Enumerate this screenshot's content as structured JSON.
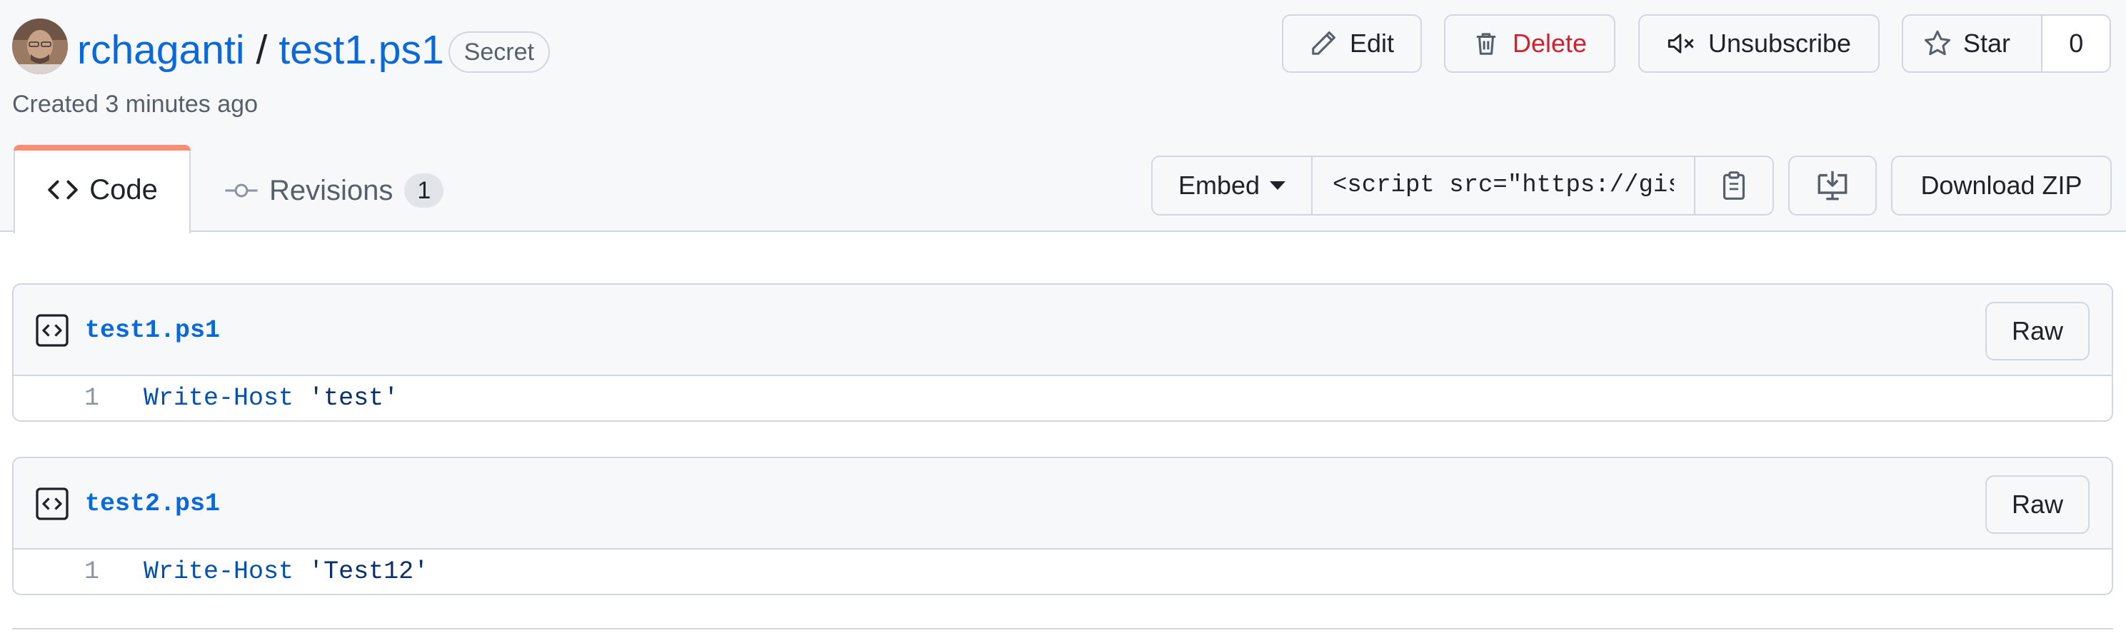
{
  "gist": {
    "owner": "rchaganti",
    "separator": "/",
    "name": "test1.ps1",
    "visibility_badge": "Secret",
    "created": "Created 3 minutes ago"
  },
  "actions": {
    "edit": "Edit",
    "delete": "Delete",
    "unsubscribe": "Unsubscribe",
    "star": "Star",
    "star_count": "0"
  },
  "tabs": {
    "code": "Code",
    "revisions": "Revisions",
    "revisions_count": "1"
  },
  "embed": {
    "mode": "Embed",
    "value": "<script src=\"https://gist.github.com/rchaganti/",
    "download_zip": "Download ZIP"
  },
  "files": [
    {
      "name": "test1.ps1",
      "raw": "Raw",
      "lines": [
        {
          "number": "1",
          "command": "Write-Host",
          "argument": "'test'"
        }
      ]
    },
    {
      "name": "test2.ps1",
      "raw": "Raw",
      "lines": [
        {
          "number": "1",
          "command": "Write-Host",
          "argument": "'Test12'"
        }
      ]
    }
  ],
  "colors": {
    "link": "#0969da",
    "danger": "#cf222e",
    "tab_accent": "#fd8c73",
    "border": "#d0d7de",
    "header_bg": "#f6f8fa"
  }
}
